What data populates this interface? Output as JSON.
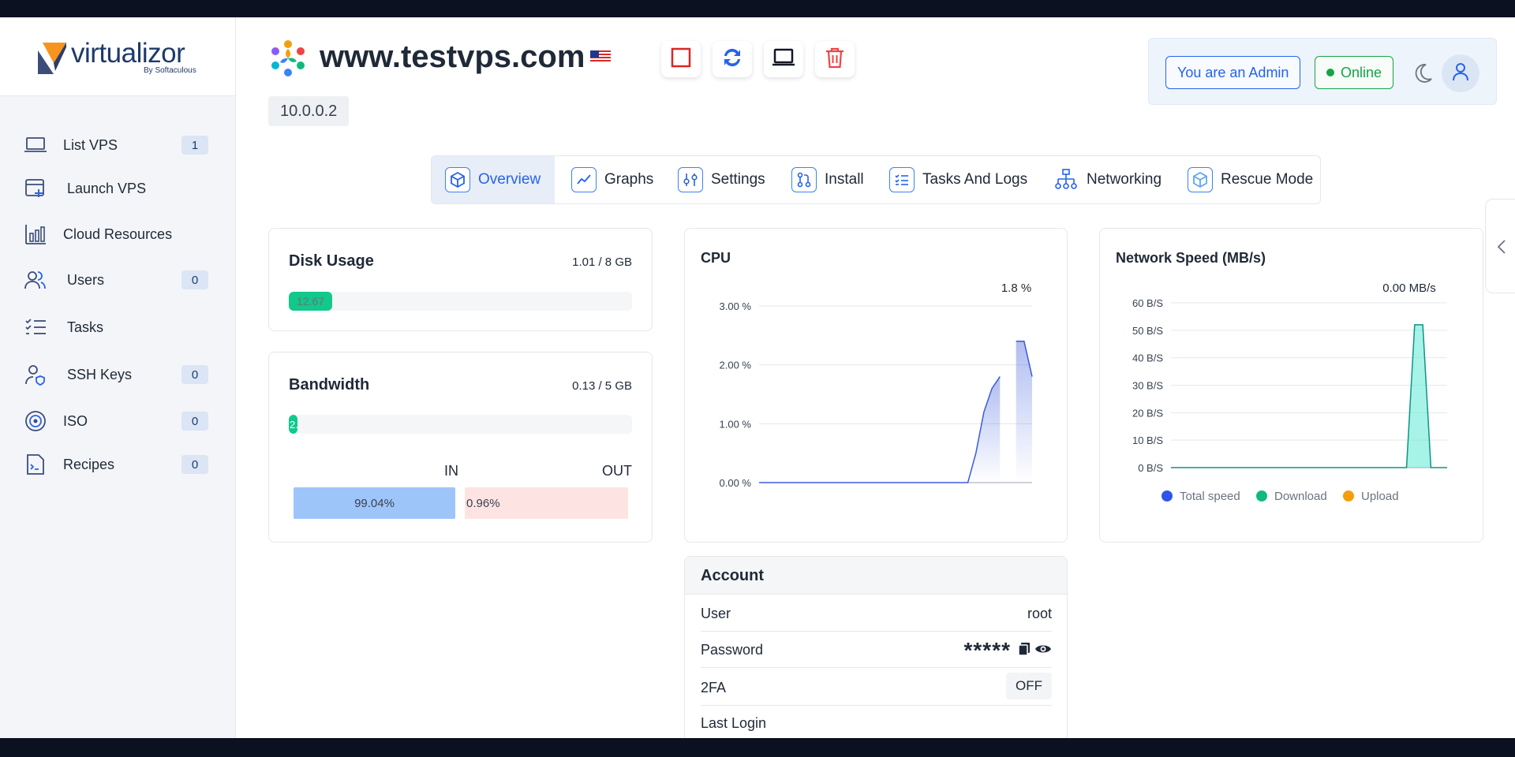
{
  "brand": {
    "name": "virtualizor",
    "sub": "By Softaculous"
  },
  "sidebar": {
    "items": [
      {
        "label": "List VPS",
        "badge": "1",
        "icon": "laptop-icon"
      },
      {
        "label": "Launch VPS",
        "badge": null,
        "icon": "window-plus-icon"
      },
      {
        "label": "Cloud Resources",
        "badge": null,
        "icon": "bar-chart-icon"
      },
      {
        "label": "Users",
        "badge": "0",
        "icon": "users-icon"
      },
      {
        "label": "Tasks",
        "badge": null,
        "icon": "checklist-icon"
      },
      {
        "label": "SSH Keys",
        "badge": "0",
        "icon": "user-key-icon"
      },
      {
        "label": "ISO",
        "badge": "0",
        "icon": "disc-icon"
      },
      {
        "label": "Recipes",
        "badge": "0",
        "icon": "recipe-doc-icon"
      }
    ]
  },
  "header": {
    "hostname": "www.testvps.com",
    "ip": "10.0.0.2",
    "admin_label": "You are an Admin",
    "online_label": "Online"
  },
  "tabs": [
    {
      "label": "Overview",
      "active": true
    },
    {
      "label": "Graphs",
      "active": false
    },
    {
      "label": "Settings",
      "active": false
    },
    {
      "label": "Install",
      "active": false
    },
    {
      "label": "Tasks And Logs",
      "active": false
    },
    {
      "label": "Networking",
      "active": false
    },
    {
      "label": "Rescue Mode",
      "active": false
    }
  ],
  "disk": {
    "title": "Disk Usage",
    "value": "1.01 / 8 GB",
    "bar_label": "12.67",
    "percent": 12.67
  },
  "bandwidth": {
    "title": "Bandwidth",
    "value": "0.13 / 5 GB",
    "bar_label": "2.",
    "percent": 2.6,
    "in_label": "IN",
    "out_label": "OUT",
    "in_pct": "99.04%",
    "out_pct": "0.96%",
    "in_share": 99.04
  },
  "cpu": {
    "title": "CPU",
    "current": "1.8 %"
  },
  "network": {
    "title": "Network Speed (MB/s)",
    "current": "0.00 MB/s"
  },
  "chart_data": [
    {
      "type": "area",
      "title": "CPU",
      "ylabel": "",
      "yticks": [
        "0.00 %",
        "1.00 %",
        "2.00 %",
        "3.00 %"
      ],
      "ylim": [
        0,
        3
      ],
      "values": [
        0,
        0,
        0,
        0,
        0,
        0,
        0,
        0,
        0,
        0,
        0,
        0,
        0,
        0,
        0,
        0,
        0,
        0,
        0,
        0,
        0,
        0,
        0,
        0,
        0,
        0,
        0,
        0.5,
        1.2,
        1.6,
        1.8,
        0,
        2.4,
        2.4,
        1.8
      ],
      "gaps": [
        31
      ],
      "color": "#3b5bdb"
    },
    {
      "type": "area",
      "title": "Network Speed (MB/s)",
      "yticks": [
        "0 B/S",
        "10 B/S",
        "20 B/S",
        "30 B/S",
        "40 B/S",
        "50 B/S",
        "60 B/S"
      ],
      "ylim": [
        0,
        60
      ],
      "series": [
        {
          "name": "Total speed",
          "color": "#2f54eb",
          "values": [
            0,
            0,
            0,
            0,
            0,
            0,
            0,
            0,
            0,
            0,
            0,
            0,
            0,
            0,
            0,
            0,
            0,
            0,
            0,
            0,
            0,
            0,
            0,
            0,
            0,
            0,
            0,
            0,
            0,
            0,
            52,
            52,
            0,
            0,
            0
          ]
        },
        {
          "name": "Download",
          "color": "#10b981",
          "values": [
            0,
            0,
            0,
            0,
            0,
            0,
            0,
            0,
            0,
            0,
            0,
            0,
            0,
            0,
            0,
            0,
            0,
            0,
            0,
            0,
            0,
            0,
            0,
            0,
            0,
            0,
            0,
            0,
            0,
            0,
            52,
            52,
            0,
            0,
            0
          ]
        },
        {
          "name": "Upload",
          "color": "#f59e0b",
          "values": [
            0,
            0,
            0,
            0,
            0,
            0,
            0,
            0,
            0,
            0,
            0,
            0,
            0,
            0,
            0,
            0,
            0,
            0,
            0,
            0,
            0,
            0,
            0,
            0,
            0,
            0,
            0,
            0,
            0,
            0,
            0,
            0,
            0,
            0,
            0
          ]
        }
      ],
      "legend": "bottom"
    }
  ],
  "account": {
    "title": "Account",
    "rows": [
      {
        "key": "User",
        "value": "root"
      },
      {
        "key": "Password",
        "value": "*****"
      },
      {
        "key": "2FA",
        "value": "OFF"
      },
      {
        "key": "Last Login",
        "value": ""
      }
    ]
  }
}
